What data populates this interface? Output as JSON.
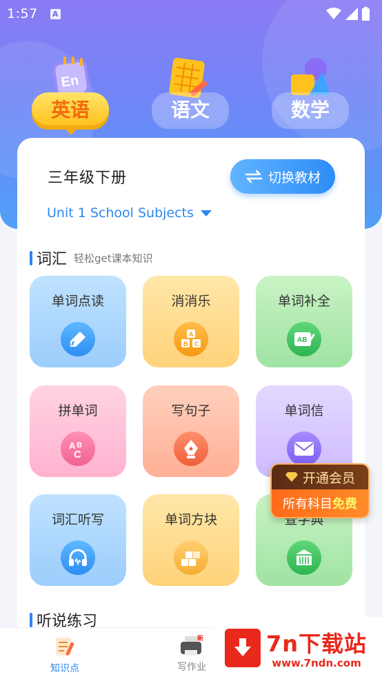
{
  "status_bar": {
    "time": "1:57",
    "notification_icon": "A"
  },
  "subjects": [
    {
      "label": "英语",
      "icon": "notebook-en-icon",
      "active": true
    },
    {
      "label": "语文",
      "icon": "grid-paper-pencil-icon",
      "active": false
    },
    {
      "label": "数学",
      "icon": "shapes-icon",
      "active": false
    }
  ],
  "textbook": {
    "grade": "三年级下册",
    "switch_label": "切换教材",
    "unit": "Unit 1 School Subjects"
  },
  "vocab_section": {
    "title": "词汇",
    "subtitle": "轻松get课本知识"
  },
  "tiles": [
    {
      "label": "单词点读",
      "icon": "pen-touch-icon"
    },
    {
      "label": "消消乐",
      "icon": "abc-blocks-icon"
    },
    {
      "label": "单词补全",
      "icon": "ab-board-icon"
    },
    {
      "label": "拼单词",
      "icon": "abc-letters-icon"
    },
    {
      "label": "写句子",
      "icon": "fountain-pen-icon"
    },
    {
      "label": "单词信",
      "icon": "envelope-icon"
    },
    {
      "label": "词汇听写",
      "icon": "headphones-icon"
    },
    {
      "label": "单词方块",
      "icon": "blocks-icon"
    },
    {
      "label": "查字典",
      "icon": "library-icon"
    }
  ],
  "listening_section": {
    "title": "听说练习"
  },
  "vip_promo": {
    "line1": "开通会员",
    "line2_prefix": "所有科目",
    "line2_highlight": "免费"
  },
  "tab_bar": [
    {
      "label": "知识点",
      "active": true
    },
    {
      "label": "写作业",
      "active": false,
      "badge": "新"
    }
  ],
  "watermark": {
    "title": "7n下载站",
    "url": "www.7ndn.com"
  },
  "colors": {
    "accent": "#2d87f0",
    "header_start": "#8b7bf4",
    "header_end": "#4f9ff8",
    "watermark": "#e8291c"
  }
}
